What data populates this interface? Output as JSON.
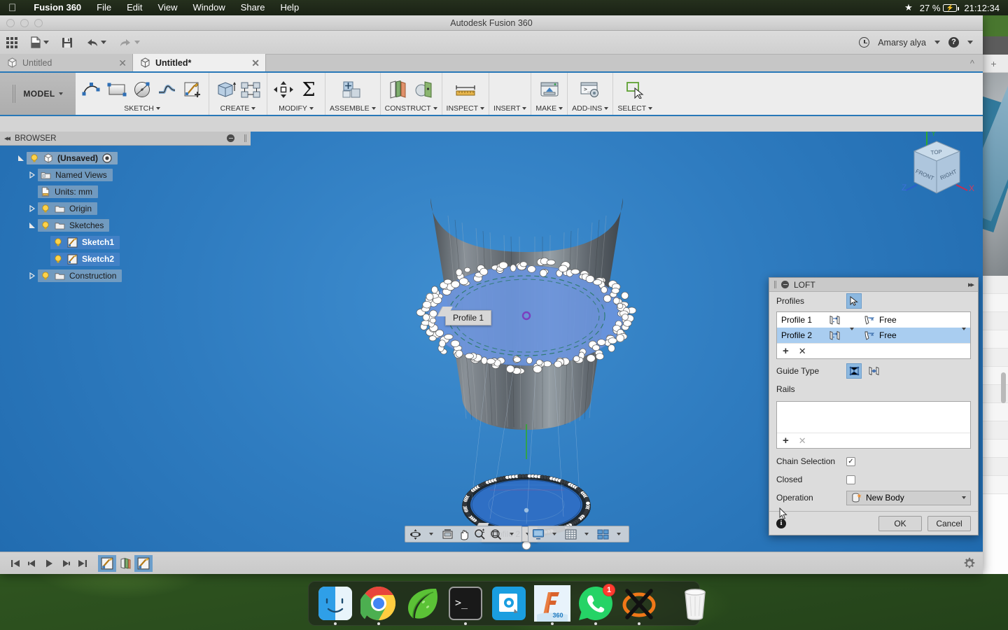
{
  "menubar": {
    "apple_icon": "apple-logo",
    "app": "Fusion 360",
    "items": [
      "File",
      "Edit",
      "View",
      "Window",
      "Share",
      "Help"
    ],
    "status": {
      "star_icon": "star-icon",
      "battery_percent": "27 %",
      "battery_icon": "battery-charging-icon",
      "clock": "21:12:34"
    }
  },
  "window": {
    "title": "Autodesk Fusion 360",
    "traffic_lights": [
      "close",
      "minimize",
      "zoom"
    ]
  },
  "apptoolbar": {
    "grid_icon": "app-grid-icon",
    "new_icon": "new-document-icon",
    "save_icon": "save-icon",
    "undo_icon": "undo-icon",
    "redo_icon": "redo-icon",
    "history_icon": "clock-history-icon",
    "account": "Amarsy alya",
    "help_icon": "help-icon"
  },
  "tabs": [
    {
      "label": "Untitled",
      "active": false,
      "close_icon": "close-icon"
    },
    {
      "label": "Untitled*",
      "active": true,
      "close_icon": "close-icon"
    }
  ],
  "ribbon": {
    "workspace": "MODEL",
    "groups": [
      {
        "label": "SKETCH",
        "icons": [
          "sketch-line-icon",
          "sketch-rectangle-icon",
          "sketch-circle-icon",
          "sketch-fillet-icon",
          "create-sketch-icon"
        ]
      },
      {
        "label": "CREATE",
        "icons": [
          "extrude-icon",
          "pattern-icon"
        ]
      },
      {
        "label": "MODIFY",
        "icons": [
          "move-icon",
          "sigma-icon"
        ]
      },
      {
        "label": "ASSEMBLE",
        "icons": [
          "new-component-icon"
        ]
      },
      {
        "label": "CONSTRUCT",
        "icons": [
          "offset-plane-icon",
          "plane-at-angle-icon"
        ]
      },
      {
        "label": "INSPECT",
        "icons": [
          "measure-icon"
        ]
      },
      {
        "label": "INSERT",
        "icons": []
      },
      {
        "label": "MAKE",
        "icons": [
          "3d-print-icon"
        ]
      },
      {
        "label": "ADD-INS",
        "icons": [
          "scripts-addins-icon"
        ]
      },
      {
        "label": "SELECT",
        "icons": [
          "select-cursor-icon"
        ]
      }
    ]
  },
  "browser": {
    "title": "BROWSER",
    "collapse_icon": "collapse-left-icon",
    "minimize_icon": "minimize-icon",
    "items": [
      {
        "label": "(Unsaved)",
        "indent": 0,
        "twisty": "expanded",
        "bulb": true,
        "icon": "component-icon",
        "style": "unsaved",
        "trailing": "display-state-icon"
      },
      {
        "label": "Named Views",
        "indent": 1,
        "twisty": "collapsed",
        "bulb": false,
        "icon": "folder-views-icon",
        "style": "normal"
      },
      {
        "label": "Units: mm",
        "indent": 1,
        "twisty": "none",
        "bulb": false,
        "icon": "units-icon",
        "style": "normal"
      },
      {
        "label": "Origin",
        "indent": 1,
        "twisty": "collapsed",
        "bulb": true,
        "icon": "folder-icon",
        "style": "normal"
      },
      {
        "label": "Sketches",
        "indent": 1,
        "twisty": "expanded",
        "bulb": true,
        "icon": "folder-icon",
        "style": "normal"
      },
      {
        "label": "Sketch1",
        "indent": 2,
        "twisty": "none",
        "bulb": true,
        "icon": "sketch-icon",
        "style": "highlight"
      },
      {
        "label": "Sketch2",
        "indent": 2,
        "twisty": "none",
        "bulb": true,
        "icon": "sketch-icon",
        "style": "highlight"
      },
      {
        "label": "Construction",
        "indent": 1,
        "twisty": "collapsed",
        "bulb": true,
        "icon": "folder-icon",
        "style": "normal"
      }
    ]
  },
  "canvas": {
    "profile_tags": [
      {
        "label": "Profile 1",
        "has_dropdown": false
      },
      {
        "label": "Profile 2",
        "has_dropdown": true
      }
    ],
    "viewcube": {
      "top": "TOP",
      "front": "FRONT",
      "right": "RIGHT",
      "axis_x": "X",
      "axis_y": "Y",
      "axis_z": "Z",
      "color_x": "#cc2b4e",
      "color_y": "#2fa82f",
      "color_z": "#2b5fcc"
    },
    "navbar": {
      "group1": [
        "orbit-icon",
        "orbit-dropdown-icon",
        "look-at-icon",
        "pan-icon",
        "zoom-icon",
        "fit-icon",
        "fit-dropdown-icon"
      ],
      "group2": [
        "display-settings-icon",
        "display-dropdown-icon",
        "grid-snaps-icon",
        "grid-dropdown-icon",
        "viewports-icon",
        "viewports-dropdown-icon"
      ]
    }
  },
  "loft": {
    "title": "LOFT",
    "minimize_icon": "minimize-icon",
    "expand_icon": "expand-right-icon",
    "profiles_label": "Profiles",
    "profiles_select_icon": "select-cursor-icon",
    "profile_rows": [
      {
        "name": "Profile 1",
        "shape_icon": "profile-shape-icon",
        "condition": "Free",
        "condition_icon": "tangency-free-icon",
        "selected": false
      },
      {
        "name": "Profile 2",
        "shape_icon": "profile-shape-icon",
        "condition": "Free",
        "condition_icon": "tangency-free-icon",
        "selected": true
      }
    ],
    "list_add_icon": "add-icon",
    "list_remove_icon": "remove-icon",
    "guide_type_label": "Guide Type",
    "guide_type_options": [
      {
        "icon": "rails-icon",
        "selected": true
      },
      {
        "icon": "centerline-icon",
        "selected": false
      }
    ],
    "rails_label": "Rails",
    "rails_add_icon": "add-icon",
    "rails_remove_icon": "remove-icon",
    "chain_selection_label": "Chain Selection",
    "chain_selection_checked": true,
    "closed_label": "Closed",
    "closed_checked": false,
    "operation_label": "Operation",
    "operation_value": "New Body",
    "operation_icon": "new-body-icon",
    "info_icon": "info-icon",
    "ok_label": "OK",
    "cancel_label": "Cancel",
    "accent_color": "#a9cdf0"
  },
  "timeline": {
    "controls": [
      "skip-to-start-icon",
      "step-back-icon",
      "play-icon",
      "step-forward-icon",
      "skip-to-end-icon"
    ],
    "features": [
      {
        "icon": "sketch-feature-icon",
        "active": true
      },
      {
        "icon": "plane-feature-icon",
        "active": false
      },
      {
        "icon": "sketch-feature-icon",
        "active": true
      }
    ],
    "settings_icon": "gear-icon"
  },
  "dock": {
    "items": [
      {
        "name": "finder-icon",
        "label": "Finder",
        "running": true,
        "badge": null
      },
      {
        "name": "chrome-icon",
        "label": "Google Chrome",
        "running": true,
        "badge": null
      },
      {
        "name": "leaf-icon",
        "label": "Leaf",
        "running": false,
        "badge": null
      },
      {
        "name": "terminal-icon",
        "label": "Terminal",
        "running": true,
        "badge": null
      },
      {
        "name": "q-app-icon",
        "label": "Q",
        "running": false,
        "badge": null
      },
      {
        "name": "fusion360-icon",
        "label": "360",
        "running": true,
        "badge": null
      },
      {
        "name": "whatsapp-icon",
        "label": "WhatsApp",
        "running": true,
        "badge": "1"
      },
      {
        "name": "xquartz-icon",
        "label": "XQuartz",
        "running": true,
        "badge": null
      },
      {
        "name": "trash-icon",
        "label": "Trash",
        "running": false,
        "badge": null
      }
    ]
  }
}
